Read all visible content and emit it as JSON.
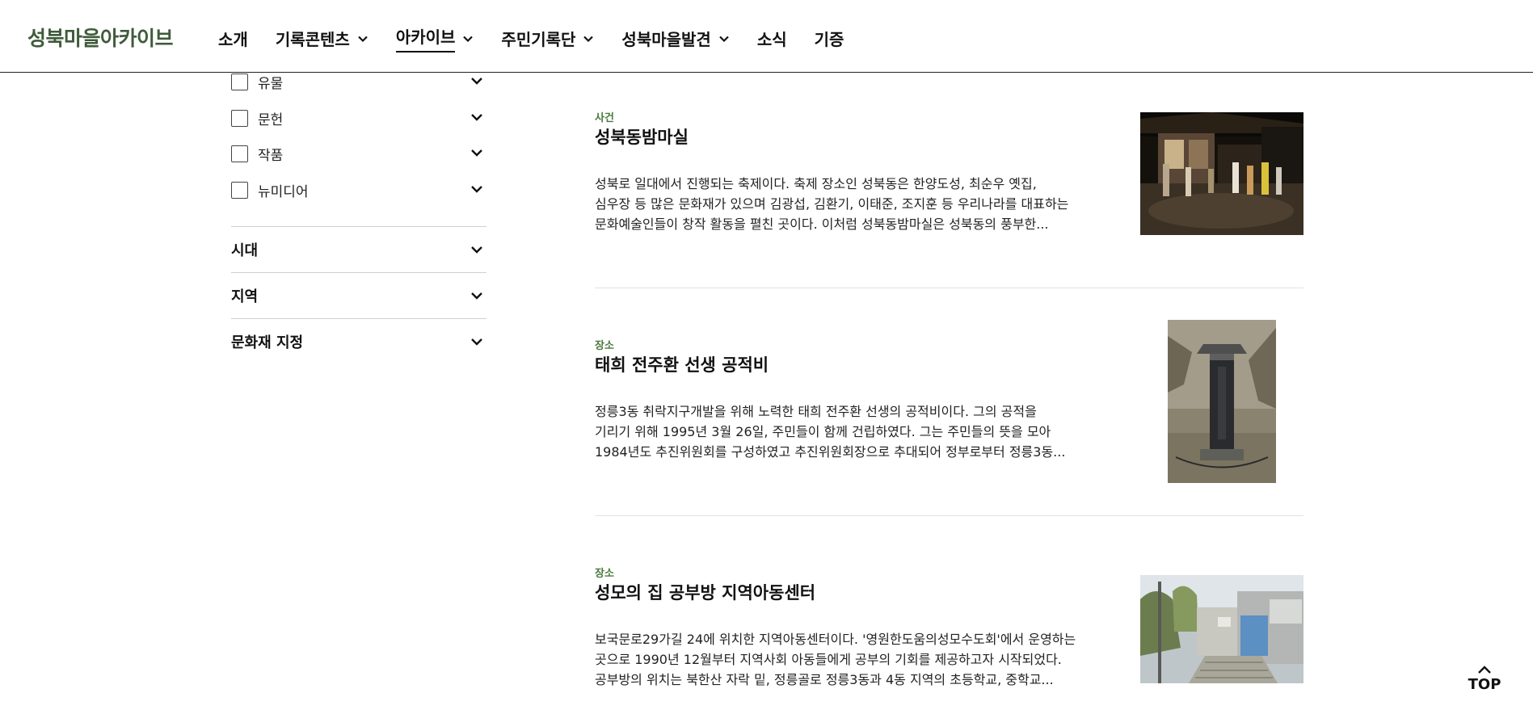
{
  "header": {
    "logo": "성북마을아카이브",
    "nav": [
      {
        "label": "소개",
        "has_dropdown": false,
        "active": false
      },
      {
        "label": "기록콘텐츠",
        "has_dropdown": true,
        "active": false
      },
      {
        "label": "아카이브",
        "has_dropdown": true,
        "active": true
      },
      {
        "label": "주민기록단",
        "has_dropdown": true,
        "active": false
      },
      {
        "label": "성북마을발견",
        "has_dropdown": true,
        "active": false
      },
      {
        "label": "소식",
        "has_dropdown": false,
        "active": false
      },
      {
        "label": "기증",
        "has_dropdown": false,
        "active": false
      }
    ]
  },
  "sidebar": {
    "types": [
      {
        "label": "유물",
        "checked": false
      },
      {
        "label": "문헌",
        "checked": false
      },
      {
        "label": "작품",
        "checked": false
      },
      {
        "label": "뉴미디어",
        "checked": false
      }
    ],
    "filters": [
      {
        "label": "시대"
      },
      {
        "label": "지역"
      },
      {
        "label": "문화재 지정"
      }
    ]
  },
  "results": [
    {
      "category": "사건",
      "title": "성북동밤마실",
      "desc": [
        "성북로 일대에서 진행되는 축제이다. 축제 장소인 성북동은 한양도성, 최순우 옛집,",
        "심우장 등 많은 문화재가 있으며 김광섭, 김환기, 이태준, 조지훈 등 우리나라를 대표하는",
        "문화예술인들이 창작 활동을 펼친 곳이다. 이처럼 성북동밤마실은 성북동의 풍부한..."
      ],
      "image": "night-festival-photo"
    },
    {
      "category": "장소",
      "title": "태희 전주환 선생 공적비",
      "desc": [
        "정릉3동 취락지구개발을 위해 노력한 태희 전주환 선생의 공적비이다. 그의 공적을",
        "기리기 위해 1995년 3월 26일, 주민들이 함께 건립하였다. 그는 주민들의 뜻을 모아",
        "1984년도 추진위원회를 구성하였고 추진위원회장으로 추대되어 정부로부터 정릉3동..."
      ],
      "image": "monument-stone-photo"
    },
    {
      "category": "장소",
      "title": "성모의 집 공부방 지역아동센터",
      "desc": [
        "보국문로29가길 24에 위치한 지역아동센터이다. '영원한도움의성모수도회'에서 운영하는",
        "곳으로 1990년 12월부터 지역사회 아동들에게 공부의 기회를 제공하고자 시작되었다.",
        "공부방의 위치는 북한산 자락 밑, 정릉골로 정릉3동과 4동 지역의 초등학교, 중학교..."
      ],
      "image": "alley-building-photo"
    }
  ],
  "top_button": {
    "label": "TOP",
    "icon": "chevron-up-icon"
  }
}
